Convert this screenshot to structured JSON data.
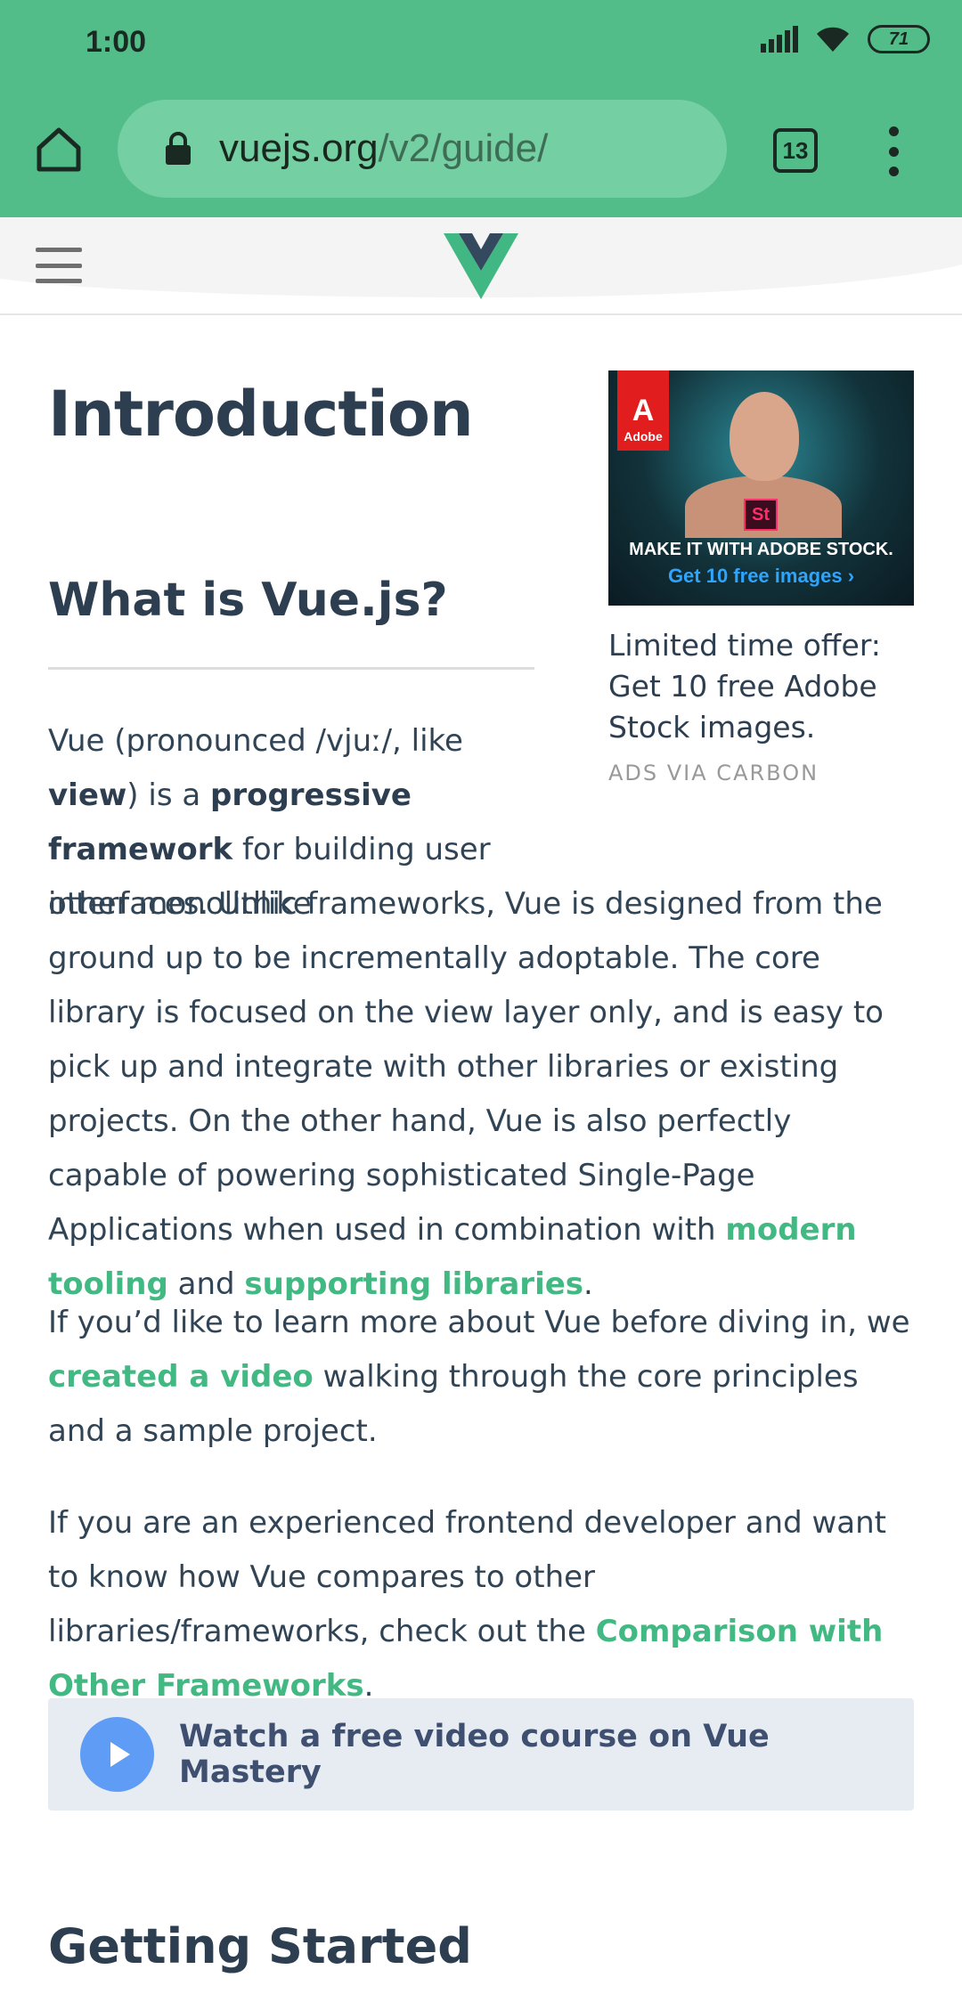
{
  "status_bar": {
    "time": "1:00",
    "battery": "71",
    "icons": [
      "signal-icon",
      "wifi-icon",
      "battery-icon"
    ]
  },
  "browser": {
    "url_domain": "vuejs.org",
    "url_path": "/v2/guide/",
    "tab_count": "13",
    "accent_color": "#52bd89"
  },
  "site_header": {
    "logo": "vue-logo-icon"
  },
  "page": {
    "title": "Introduction",
    "section_heading": "What is Vue.js?",
    "para1": {
      "t1": "Vue (pronounced /vjuː/, like ",
      "b1": "view",
      "t2": ") is a ",
      "b2": "progressive framework",
      "t3": " for building user interfaces. Unlike"
    },
    "para1b": {
      "t1": "other monolithic frameworks, Vue is designed from the ground up to be incrementally adoptable. The core library is focused on the view layer only, and is easy to pick up and integrate with other libraries or existing projects. On the other hand, Vue is also perfectly capable of powering sophisticated Single-Page Applications when used in combination with ",
      "link1": "modern tooling",
      "t2": " and ",
      "link2": "supporting libraries",
      "t3": "."
    },
    "para2": {
      "t1": "If you’d like to learn more about Vue before diving in, we ",
      "link1": "created a video",
      "t2": " walking through the core principles and a sample project."
    },
    "para3": {
      "t1": "If you are an experienced frontend developer and want to know how Vue compares to other libraries/frameworks, check out the ",
      "link1": "Comparison with Other Frameworks",
      "t2": "."
    },
    "video_course": "Watch a free video course on Vue Mastery",
    "next_heading": "Getting Started",
    "link_color": "#42b983"
  },
  "ad": {
    "brand": "Adobe",
    "product_badge": "St",
    "banner_line1": "MAKE IT WITH ADOBE STOCK.",
    "banner_line2": "Get 10 free images ›",
    "text": "Limited time offer: Get 10 free Adobe Stock images.",
    "via": "ADS VIA CARBON"
  }
}
